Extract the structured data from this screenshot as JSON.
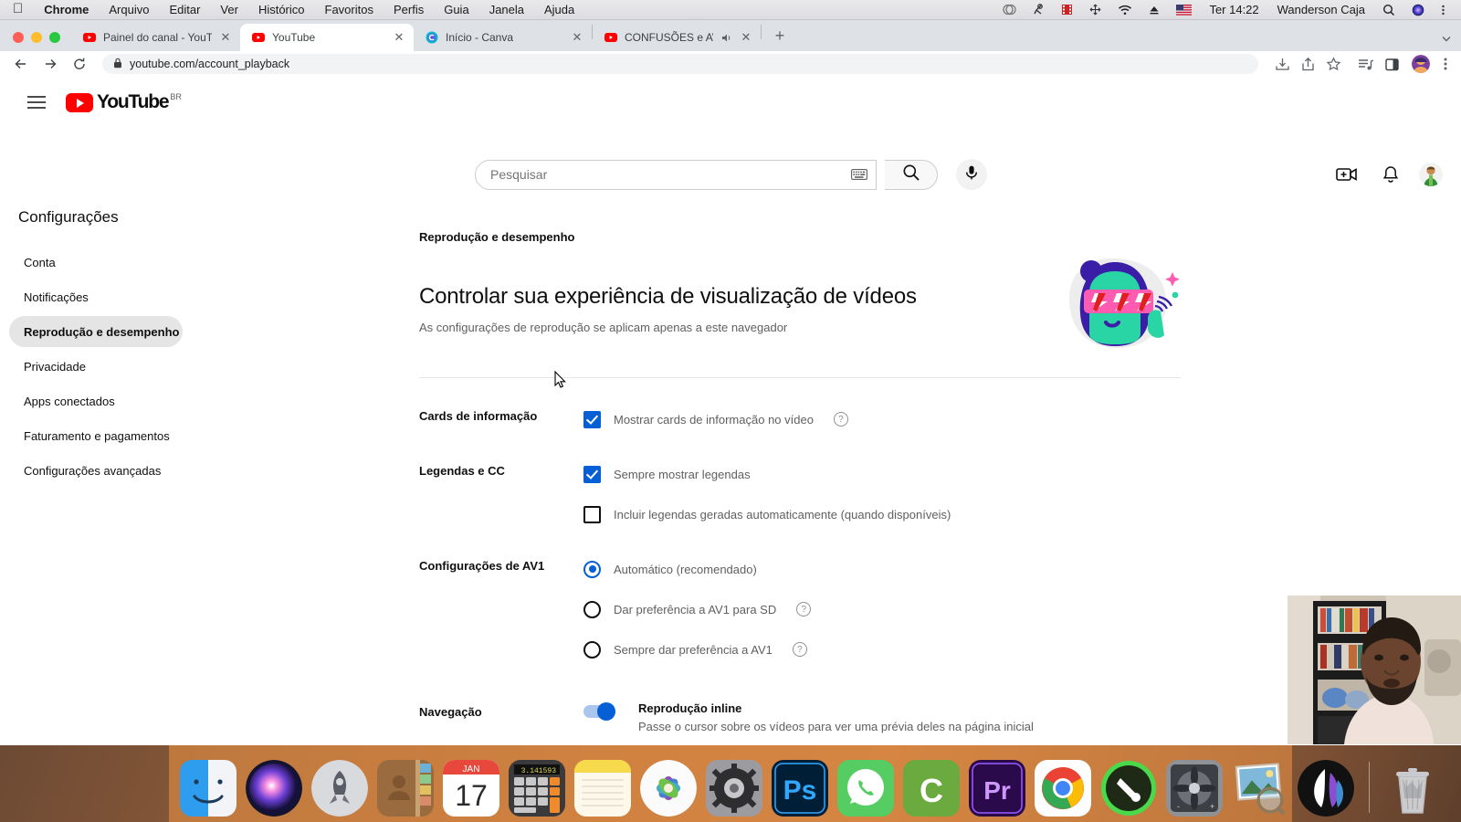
{
  "menubar": {
    "apple": "apple-logo",
    "items": [
      "Chrome",
      "Arquivo",
      "Editar",
      "Ver",
      "Histórico",
      "Favoritos",
      "Perfis",
      "Guia",
      "Janela",
      "Ajuda"
    ],
    "status_icons": [
      "dropbox-icon",
      "alfred-icon",
      "screen-recorder-icon",
      "move-icon",
      "wifi-icon",
      "eject-icon",
      "flag-us-icon"
    ],
    "clock": "Ter 14:22",
    "user": "Wanderson Caja",
    "search_icon": "spotlight-search-icon",
    "siri_icon": "siri-icon",
    "control_center_icon": "control-center-icon"
  },
  "browser": {
    "tabs": [
      {
        "title": "Painel do canal - YouTube Stud",
        "favicon": "youtube-favicon",
        "active": false,
        "audio": false
      },
      {
        "title": "YouTube",
        "favicon": "youtube-favicon",
        "active": true,
        "audio": false
      },
      {
        "title": "Início - Canva",
        "favicon": "canva-favicon",
        "active": false,
        "audio": false
      },
      {
        "title": "CONFUSÕES e AVENTURA",
        "favicon": "youtube-favicon",
        "active": false,
        "audio": true
      }
    ],
    "new_tab_label": "+",
    "close_label": "✕",
    "url": "youtube.com/account_playback",
    "toolbar_icons": [
      "back-icon",
      "forward-icon",
      "reload-icon",
      "install-icon",
      "share-icon",
      "bookmark-star-icon",
      "reading-list-icon",
      "side-panel-icon",
      "profile-avatar",
      "chrome-menu-icon"
    ]
  },
  "youtube": {
    "menu_icon": "hamburger-menu-icon",
    "logo_text": "YouTube",
    "logo_country": "BR",
    "search": {
      "placeholder": "Pesquisar",
      "value": "",
      "keyboard_icon": "keyboard-icon",
      "search_icon": "search-icon",
      "mic_icon": "microphone-icon"
    },
    "header_right": {
      "create_icon": "create-video-icon",
      "notifications_icon": "notifications-bell-icon",
      "avatar": "user-avatar"
    }
  },
  "settings": {
    "title": "Configurações",
    "nav_items": [
      {
        "label": "Conta",
        "active": false
      },
      {
        "label": "Notificações",
        "active": false
      },
      {
        "label": "Reprodução e desempenho",
        "active": true
      },
      {
        "label": "Privacidade",
        "active": false
      },
      {
        "label": "Apps conectados",
        "active": false
      },
      {
        "label": "Faturamento e pagamentos",
        "active": false
      },
      {
        "label": "Configurações avançadas",
        "active": false
      }
    ],
    "kicker": "Reprodução e desempenho",
    "heading": "Controlar sua experiência de visualização de vídeos",
    "subheading": "As configurações de reprodução se aplicam apenas a este navegador",
    "illustration": "person-with-lightning-sunglasses-illustration",
    "sections": [
      {
        "label": "Cards de informação",
        "options": [
          {
            "type": "checkbox",
            "checked": true,
            "label": "Mostrar cards de informação no vídeo",
            "help": true
          }
        ]
      },
      {
        "label": "Legendas e CC",
        "options": [
          {
            "type": "checkbox",
            "checked": true,
            "label": "Sempre mostrar legendas",
            "help": false
          },
          {
            "type": "checkbox",
            "checked": false,
            "label": "Incluir legendas geradas automaticamente (quando disponíveis)",
            "help": false
          }
        ]
      },
      {
        "label": "Configurações de AV1",
        "options": [
          {
            "type": "radio",
            "checked": true,
            "label": "Automático (recomendado)",
            "help": false
          },
          {
            "type": "radio",
            "checked": false,
            "label": "Dar preferência a AV1 para SD",
            "help": true
          },
          {
            "type": "radio",
            "checked": false,
            "label": "Sempre dar preferência a AV1",
            "help": true
          }
        ]
      },
      {
        "label": "Navegação",
        "options": [
          {
            "type": "toggle",
            "checked": true,
            "label": "Reprodução inline",
            "description": "Passe o cursor sobre os vídeos para ver uma prévia deles na página inicial",
            "help": false
          }
        ]
      }
    ],
    "help_glyph": "?"
  },
  "overlay": {
    "webcam": "webcam-video-overlay",
    "cursor": "mouse-cursor"
  },
  "dock": {
    "apps": [
      {
        "name": "finder-icon",
        "running": true
      },
      {
        "name": "siri-icon",
        "running": false
      },
      {
        "name": "launchpad-icon",
        "running": false
      },
      {
        "name": "contacts-icon",
        "running": false
      },
      {
        "name": "calendar-icon",
        "running": false,
        "month": "JAN",
        "day": "17"
      },
      {
        "name": "calculator-icon",
        "running": false
      },
      {
        "name": "notes-icon",
        "running": false
      },
      {
        "name": "photos-icon",
        "running": false
      },
      {
        "name": "system-preferences-icon",
        "running": false
      },
      {
        "name": "photoshop-icon",
        "running": true,
        "label": "Ps"
      },
      {
        "name": "whatsapp-icon",
        "running": true
      },
      {
        "name": "camtasia-icon",
        "running": true,
        "label": "C"
      },
      {
        "name": "premiere-pro-icon",
        "running": false,
        "label": "Pr"
      },
      {
        "name": "chrome-icon",
        "running": true
      },
      {
        "name": "screenflow-icon",
        "running": true
      },
      {
        "name": "cleaner-icon",
        "running": false
      },
      {
        "name": "preview-icon",
        "running": false
      },
      {
        "name": "affinity-icon",
        "running": false
      }
    ],
    "trash": "trash-icon"
  },
  "colors": {
    "accent_blue": "#065fd4",
    "youtube_red": "#ff0000",
    "sidebar_active_bg": "#e5e5e5",
    "text_primary": "#0f0f0f",
    "text_secondary": "#606060"
  }
}
